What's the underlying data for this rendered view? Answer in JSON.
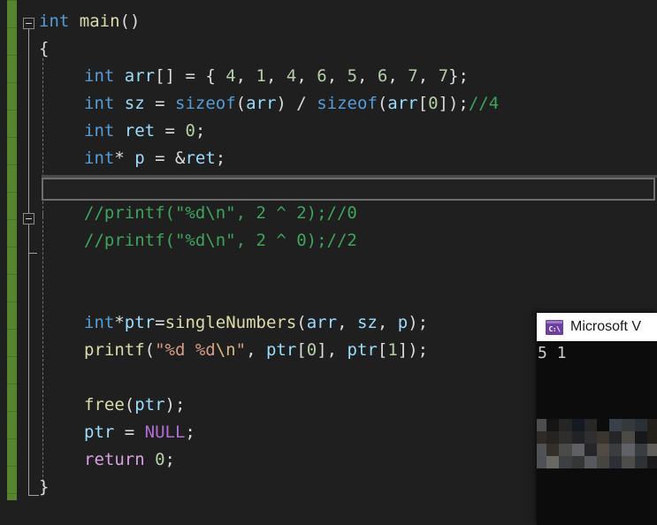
{
  "app": {
    "name": "visual-studio-code-editor",
    "theme": "dark",
    "background": "#1f1f1f"
  },
  "editor": {
    "language": "C",
    "font_size_px": 19,
    "line_height_px": 31,
    "change_bar_color": "#57842f",
    "lines": [
      {
        "n": 1,
        "indent": 0,
        "outline": "collapse-minus",
        "tokens": [
          {
            "t": "int",
            "c": "kw"
          },
          {
            "t": " ",
            "c": "punc"
          },
          {
            "t": "main",
            "c": "fn"
          },
          {
            "t": "()",
            "c": "punc"
          }
        ]
      },
      {
        "n": 2,
        "indent": 1,
        "tokens": [
          {
            "t": "{",
            "c": "punc"
          }
        ]
      },
      {
        "n": 3,
        "indent": 2,
        "tokens": [
          {
            "t": "int",
            "c": "kw"
          },
          {
            "t": " ",
            "c": "punc"
          },
          {
            "t": "arr",
            "c": "var"
          },
          {
            "t": "[]",
            "c": "brk"
          },
          {
            "t": " = { ",
            "c": "punc"
          },
          {
            "t": "4",
            "c": "num"
          },
          {
            "t": ", ",
            "c": "punc"
          },
          {
            "t": "1",
            "c": "num"
          },
          {
            "t": ", ",
            "c": "punc"
          },
          {
            "t": "4",
            "c": "num"
          },
          {
            "t": ", ",
            "c": "punc"
          },
          {
            "t": "6",
            "c": "num"
          },
          {
            "t": ", ",
            "c": "punc"
          },
          {
            "t": "5",
            "c": "num"
          },
          {
            "t": ", ",
            "c": "punc"
          },
          {
            "t": "6",
            "c": "num"
          },
          {
            "t": ", ",
            "c": "punc"
          },
          {
            "t": "7",
            "c": "num"
          },
          {
            "t": ", ",
            "c": "punc"
          },
          {
            "t": "7",
            "c": "num"
          },
          {
            "t": "};",
            "c": "punc"
          }
        ]
      },
      {
        "n": 4,
        "indent": 2,
        "tokens": [
          {
            "t": "int",
            "c": "kw"
          },
          {
            "t": " ",
            "c": "punc"
          },
          {
            "t": "sz",
            "c": "var"
          },
          {
            "t": " = ",
            "c": "punc"
          },
          {
            "t": "sizeof",
            "c": "kw"
          },
          {
            "t": "(",
            "c": "punc"
          },
          {
            "t": "arr",
            "c": "var"
          },
          {
            "t": ") / ",
            "c": "punc"
          },
          {
            "t": "sizeof",
            "c": "kw"
          },
          {
            "t": "(",
            "c": "punc"
          },
          {
            "t": "arr",
            "c": "var"
          },
          {
            "t": "[",
            "c": "brk"
          },
          {
            "t": "0",
            "c": "num"
          },
          {
            "t": "]",
            "c": "brk"
          },
          {
            "t": ");",
            "c": "punc"
          },
          {
            "t": "//4",
            "c": "cmt"
          }
        ]
      },
      {
        "n": 5,
        "indent": 2,
        "tokens": [
          {
            "t": "int",
            "c": "kw"
          },
          {
            "t": " ",
            "c": "punc"
          },
          {
            "t": "ret",
            "c": "var"
          },
          {
            "t": " = ",
            "c": "punc"
          },
          {
            "t": "0",
            "c": "num"
          },
          {
            "t": ";",
            "c": "punc"
          }
        ]
      },
      {
        "n": 6,
        "indent": 2,
        "tokens": [
          {
            "t": "int",
            "c": "kw"
          },
          {
            "t": "* ",
            "c": "punc"
          },
          {
            "t": "p",
            "c": "var"
          },
          {
            "t": " = &",
            "c": "punc"
          },
          {
            "t": "ret",
            "c": "var"
          },
          {
            "t": ";",
            "c": "punc"
          }
        ]
      },
      {
        "n": 7,
        "indent": 2,
        "region_box": true,
        "tokens": []
      },
      {
        "n": 8,
        "indent": 2,
        "outline": "collapse-minus",
        "tokens": [
          {
            "t": "//printf(\"%d\\n\", 2 ^ 2);//0",
            "c": "cmt"
          }
        ]
      },
      {
        "n": 9,
        "indent": 2,
        "tokens": [
          {
            "t": "//printf(\"%d\\n\", 2 ^ 0);//2",
            "c": "cmt"
          }
        ]
      },
      {
        "n": 10,
        "indent": 2,
        "tokens": []
      },
      {
        "n": 11,
        "indent": 2,
        "tokens": []
      },
      {
        "n": 12,
        "indent": 2,
        "tokens": [
          {
            "t": "int",
            "c": "kw"
          },
          {
            "t": "*",
            "c": "punc"
          },
          {
            "t": "ptr",
            "c": "var"
          },
          {
            "t": "=",
            "c": "punc"
          },
          {
            "t": "singleNumbers",
            "c": "fn"
          },
          {
            "t": "(",
            "c": "punc"
          },
          {
            "t": "arr",
            "c": "var"
          },
          {
            "t": ", ",
            "c": "punc"
          },
          {
            "t": "sz",
            "c": "var"
          },
          {
            "t": ", ",
            "c": "punc"
          },
          {
            "t": "p",
            "c": "var"
          },
          {
            "t": ");",
            "c": "punc"
          }
        ]
      },
      {
        "n": 13,
        "indent": 2,
        "tokens": [
          {
            "t": "printf",
            "c": "fn"
          },
          {
            "t": "(",
            "c": "punc"
          },
          {
            "t": "\"%d %d",
            "c": "str"
          },
          {
            "t": "\\n",
            "c": "esc"
          },
          {
            "t": "\"",
            "c": "str"
          },
          {
            "t": ", ",
            "c": "punc"
          },
          {
            "t": "ptr",
            "c": "var"
          },
          {
            "t": "[",
            "c": "brk"
          },
          {
            "t": "0",
            "c": "num"
          },
          {
            "t": "]",
            "c": "brk"
          },
          {
            "t": ", ",
            "c": "punc"
          },
          {
            "t": "ptr",
            "c": "var"
          },
          {
            "t": "[",
            "c": "brk"
          },
          {
            "t": "1",
            "c": "num"
          },
          {
            "t": "]",
            "c": "brk"
          },
          {
            "t": ");",
            "c": "punc"
          }
        ]
      },
      {
        "n": 14,
        "indent": 2,
        "tokens": []
      },
      {
        "n": 15,
        "indent": 2,
        "tokens": [
          {
            "t": "free",
            "c": "fn"
          },
          {
            "t": "(",
            "c": "punc"
          },
          {
            "t": "ptr",
            "c": "var"
          },
          {
            "t": ");",
            "c": "punc"
          }
        ]
      },
      {
        "n": 16,
        "indent": 2,
        "tokens": [
          {
            "t": "ptr",
            "c": "var"
          },
          {
            "t": " = ",
            "c": "punc"
          },
          {
            "t": "NULL",
            "c": "macro"
          },
          {
            "t": ";",
            "c": "punc"
          }
        ]
      },
      {
        "n": 17,
        "indent": 2,
        "tokens": [
          {
            "t": "return",
            "c": "ctrl"
          },
          {
            "t": " ",
            "c": "punc"
          },
          {
            "t": "0",
            "c": "num"
          },
          {
            "t": ";",
            "c": "punc"
          }
        ]
      },
      {
        "n": 18,
        "indent": 1,
        "tokens": [
          {
            "t": "}",
            "c": "punc"
          }
        ]
      }
    ]
  },
  "console": {
    "title": "Microsoft V",
    "title_full": "Microsoft Visual Studio Debug Console",
    "icon": "console-icon",
    "icon_text": "C:\\",
    "output_lines": [
      "5 1"
    ],
    "background": "#0c0c0c",
    "text_color": "#cccccc",
    "censored_block": {
      "label": "pixelated-redacted-output",
      "cols": 10,
      "rows": 4,
      "colors": [
        "#4d4d4d",
        "#151515",
        "#252525",
        "#141a20",
        "#272727",
        "#0c0c0c",
        "#394048",
        "#35383c",
        "#2b3038",
        "#231f1a",
        "#2e2a26",
        "#272320",
        "#2d2d2d",
        "#232325",
        "#2f2f2f",
        "#3a352f",
        "#262628",
        "#4b4a44",
        "#17181a",
        "#222019",
        "#4f5256",
        "#352f2a",
        "#4a4a4a",
        "#5f6064",
        "#262628",
        "#514b47",
        "#3a3c3e",
        "#606267",
        "#3b3c3f",
        "#5f5d59",
        "#4e5155",
        "#6a6864",
        "#3d4042",
        "#363636",
        "#565a5d",
        "#46453f",
        "#2c3034",
        "#4e4d4c",
        "#2e3136",
        "#1a1a1a"
      ]
    }
  }
}
